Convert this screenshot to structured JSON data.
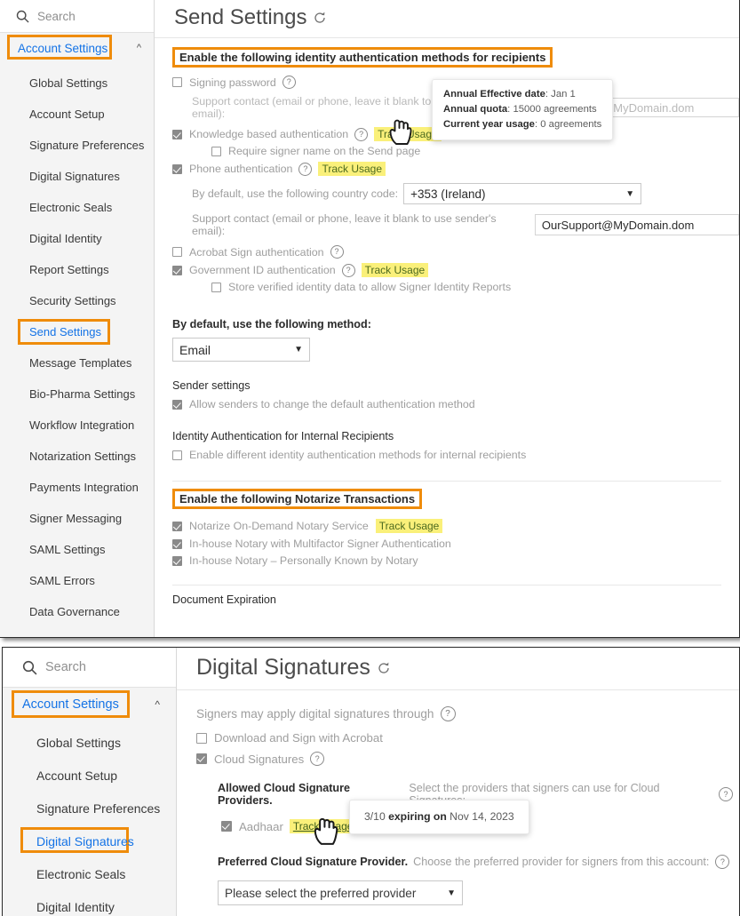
{
  "panel_top": {
    "search": {
      "placeholder": "Search",
      "icon": "search-icon"
    },
    "sidebar": {
      "group_label": "Account Settings",
      "chevron": "⌃",
      "items": [
        {
          "label": "Global Settings",
          "active": false
        },
        {
          "label": "Account Setup",
          "active": false
        },
        {
          "label": "Signature Preferences",
          "active": false
        },
        {
          "label": "Digital Signatures",
          "active": false
        },
        {
          "label": "Electronic Seals",
          "active": false
        },
        {
          "label": "Digital Identity",
          "active": false
        },
        {
          "label": "Report Settings",
          "active": false
        },
        {
          "label": "Security Settings",
          "active": false
        },
        {
          "label": "Send Settings",
          "active": true
        },
        {
          "label": "Message Templates",
          "active": false
        },
        {
          "label": "Bio-Pharma Settings",
          "active": false
        },
        {
          "label": "Workflow Integration",
          "active": false
        },
        {
          "label": "Notarization Settings",
          "active": false
        },
        {
          "label": "Payments Integration",
          "active": false
        },
        {
          "label": "Signer Messaging",
          "active": false
        },
        {
          "label": "SAML Settings",
          "active": false
        },
        {
          "label": "SAML Errors",
          "active": false
        },
        {
          "label": "Data Governance",
          "active": false
        }
      ]
    },
    "title": "Send Settings",
    "section_identity": "Enable the following identity authentication methods for recipients",
    "rows": {
      "signing_password": "Signing password",
      "support_contact_1": "Support contact (email or phone, leave it blank to use sender's email):",
      "support_email_1": "OurSupport@MyDomain.dom",
      "kba": "Knowledge based authentication",
      "kba_track": "Track Usage",
      "require_signer_name": "Require signer name on the Send page",
      "phone_auth": "Phone authentication",
      "phone_track": "Track Usage",
      "country_code_label": "By default, use the following country code:",
      "country_code_value": "+353 (Ireland)",
      "support_contact_2": "Support contact (email or phone, leave it blank to use sender's email):",
      "support_email_2": "OurSupport@MyDomain.dom",
      "acrobat_sign_auth": "Acrobat Sign authentication",
      "gov_id_auth": "Government ID authentication",
      "gov_id_track": "Track Usage",
      "store_verified": "Store verified identity data to allow Signer Identity Reports"
    },
    "default_method_label": "By default, use the following method:",
    "default_method_value": "Email",
    "sender_settings_label": "Sender settings",
    "allow_senders": "Allow senders to change the default authentication method",
    "internal_recipients_label": "Identity Authentication for Internal Recipients",
    "enable_different": "Enable different identity authentication methods for internal recipients",
    "section_notarize": "Enable the following Notarize Transactions",
    "notarize_rows": [
      {
        "label": "Notarize On-Demand Notary Service",
        "track": "Track Usage",
        "checked": true
      },
      {
        "label": "In-house Notary with Multifactor Signer Authentication",
        "track": "",
        "checked": true
      },
      {
        "label": "In-house Notary – Personally Known by Notary",
        "track": "",
        "checked": true
      }
    ],
    "document_expiration": "Document Expiration",
    "tooltip": {
      "line1_label": "Annual Effective date",
      "line1_value": ": Jan 1",
      "line2_label": "Annual quota",
      "line2_value": ": 15000 agreements",
      "line3_label": "Current year usage",
      "line3_value": ": 0 agreements"
    }
  },
  "panel_bottom": {
    "search": {
      "placeholder": "Search",
      "icon": "search-icon"
    },
    "sidebar": {
      "group_label": "Account Settings",
      "chevron": "⌃",
      "items": [
        {
          "label": "Global Settings",
          "active": false
        },
        {
          "label": "Account Setup",
          "active": false
        },
        {
          "label": "Signature Preferences",
          "active": false
        },
        {
          "label": "Digital Signatures",
          "active": true
        },
        {
          "label": "Electronic Seals",
          "active": false
        },
        {
          "label": "Digital Identity",
          "active": false
        }
      ]
    },
    "title": "Digital Signatures",
    "signers_may_apply": "Signers may apply digital signatures through",
    "download_and_sign": "Download and Sign with Acrobat",
    "cloud_signatures": "Cloud Signatures",
    "allowed_heading": "Allowed Cloud Signature Providers.",
    "allowed_desc": "Select the providers that signers can use for Cloud Signatures:",
    "aadhaar": "Aadhaar",
    "aadhaar_track": "Track Usage",
    "preferred_heading": "Preferred Cloud Signature Provider.",
    "preferred_desc": "Choose the preferred provider for signers from this account:",
    "preferred_select_value": "Please select the preferred provider",
    "tooltip": {
      "count": "3/10 ",
      "expiring": "expiring on",
      "date": " Nov 14, 2023"
    }
  },
  "colors": {
    "highlight_box": "#ef8c0b",
    "link": "#1473e6",
    "track_bg": "#faf07a",
    "track_text": "#4c6a1f"
  }
}
